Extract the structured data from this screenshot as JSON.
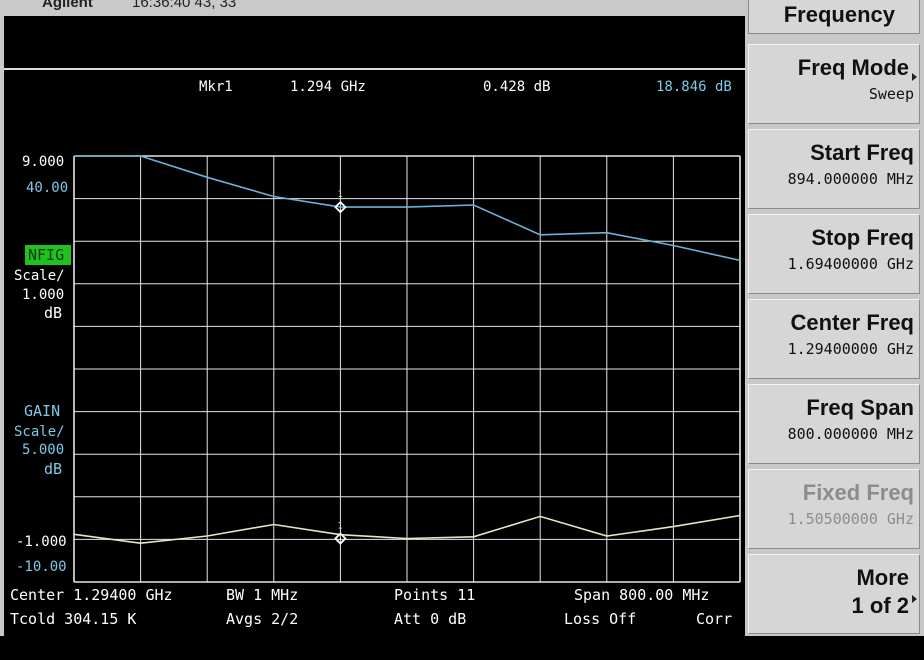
{
  "titlebar": {
    "brand": "Agilent",
    "clock": "16:36:40 43, 33"
  },
  "marker": {
    "name": "Mkr1",
    "freq": "1.294 GHz",
    "value1": "0.428 dB",
    "value2": "18.846 dB"
  },
  "nfig": {
    "top_ref": "9.000",
    "bottom_ref": "-1.000",
    "label": "NFIG",
    "scale_label": "Scale/",
    "scale_value": "1.000",
    "unit": "dB",
    "color": "#6bb3d6",
    "values": [
      9.0,
      9.0,
      8.5,
      8.05,
      7.8,
      7.8,
      7.85,
      7.15,
      7.2,
      6.9,
      6.55
    ],
    "marker_value": 7.8
  },
  "gain": {
    "top_ref": "40.00",
    "bottom_ref": "-10.00",
    "label": "GAIN",
    "scale_label": "Scale/",
    "scale_value": "5.000",
    "unit": "dB",
    "color": "#e8e6c0",
    "values": [
      -4.4,
      -5.45,
      -4.6,
      -3.25,
      -4.45,
      -4.9,
      -4.7,
      -2.3,
      -4.6,
      -3.5,
      -2.2
    ],
    "marker_value": -4.9
  },
  "status": {
    "center": "Center 1.29400 GHz",
    "bw": "BW 1 MHz",
    "points": "Points 11",
    "span": "Span 800.00 MHz",
    "tcold": "Tcold 304.15 K",
    "avgs": "Avgs 2/2",
    "att": "Att 0 dB",
    "loss": "Loss Off",
    "corr": "Corr"
  },
  "menu": {
    "title": "Frequency",
    "keys": [
      {
        "label": "Freq Mode",
        "value": "Sweep",
        "submenu": true
      },
      {
        "label": "Start Freq",
        "value": "894.000000 MHz"
      },
      {
        "label": "Stop Freq",
        "value": "1.69400000 GHz"
      },
      {
        "label": "Center Freq",
        "value": "1.29400000 GHz"
      },
      {
        "label": "Freq Span",
        "value": "800.000000 MHz"
      },
      {
        "label": "Fixed Freq",
        "value": "1.50500000 GHz",
        "disabled": true
      },
      {
        "label": "More",
        "value": "1 of 2",
        "submenu": true
      }
    ]
  },
  "colors": {
    "grid": "#e6e6e6",
    "label_cyan": "#7fc8e6",
    "nfig_bg": "#1fc21f",
    "text": "#ffffff"
  }
}
